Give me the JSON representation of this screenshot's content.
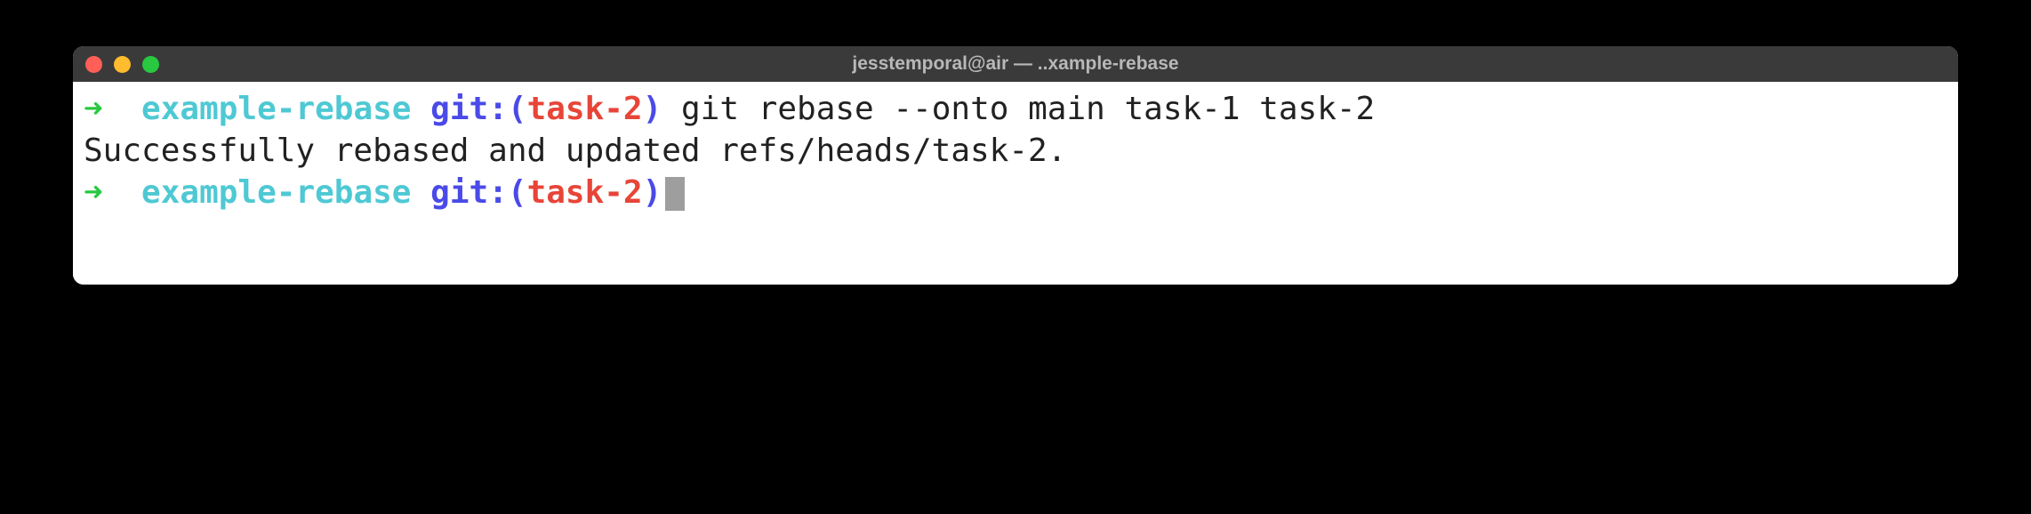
{
  "window": {
    "title": "jesstemporal@air — ..xample-rebase"
  },
  "prompt": {
    "arrow": "➜",
    "directory": "example-rebase",
    "git_label": "git:",
    "paren_open": "(",
    "branch": "task-2",
    "paren_close": ")"
  },
  "lines": {
    "line1_command": " git rebase --onto main task-1 task-2",
    "line2_output": "Successfully rebased and updated refs/heads/task-2."
  }
}
